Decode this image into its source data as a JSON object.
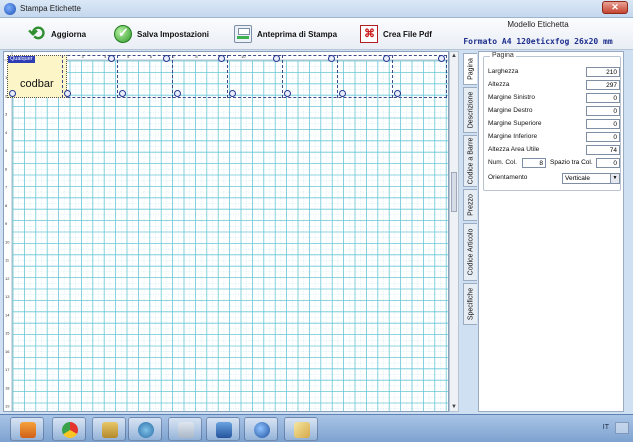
{
  "window": {
    "title": "Stampa Etichette"
  },
  "toolbar": {
    "refresh_label": "Aggiorna",
    "save_label": "Salva Impostazioni",
    "preview_label": "Anteprima di Stampa",
    "pdf_label": "Crea File Pdf"
  },
  "model": {
    "label": "Modello Etichetta",
    "value": "Formato A4 120eticxfog 26x20 mm"
  },
  "canvas": {
    "label_tag": "Qualquer",
    "label_text": "codbar",
    "ruler_marks": [
      "1",
      "2",
      "3",
      "4",
      "5",
      "6",
      "7",
      "8",
      "9",
      "10",
      "11",
      "12",
      "13",
      "14",
      "15",
      "16",
      "17",
      "18",
      "19"
    ]
  },
  "tabs": [
    "Pagina",
    "Descrizione",
    "Codice a Barre",
    "Prezzo",
    "Codice Articolo",
    "Specifiche"
  ],
  "panel": {
    "group_title": "Pagina",
    "fields": [
      {
        "label": "Larghezza",
        "value": "210"
      },
      {
        "label": "Altezza",
        "value": "297"
      },
      {
        "label": "Margine Sinistro",
        "value": "0"
      },
      {
        "label": "Margine Destro",
        "value": "0"
      },
      {
        "label": "Margine Superiore",
        "value": "0"
      },
      {
        "label": "Margine Inferiore",
        "value": "0"
      },
      {
        "label": "Altezza Area Utile",
        "value": "74"
      }
    ],
    "num_col_label": "Num. Col.",
    "num_col_value": "8",
    "spacing_label": "Spazio tra Col.",
    "spacing_value": "0",
    "orientation_label": "Orientamento",
    "orientation_value": "Verticale"
  },
  "taskbar": {
    "locale": "IT",
    "apps": [
      "media-player",
      "chrome",
      "app-3",
      "paint-tools",
      "calculator",
      "remote-desktop",
      "globe",
      "paint-brush"
    ]
  },
  "colors": {
    "grid": "#68c7d6",
    "accent": "#1d2e8c",
    "label_bg": "#fbf5c8"
  }
}
